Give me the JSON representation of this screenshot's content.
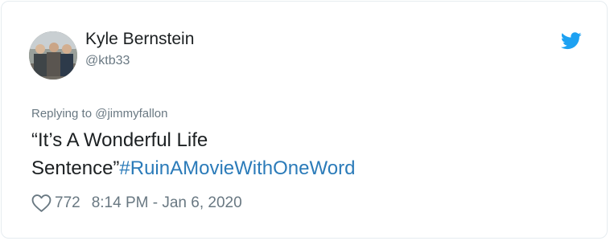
{
  "tweet": {
    "author": {
      "display_name": "Kyle Bernstein",
      "handle": "@ktb33"
    },
    "reply": {
      "prefix": "Replying to",
      "target": "@jimmyfallon"
    },
    "text_line1": "“It’s A Wonderful Life",
    "text_line2": "Sentence”",
    "hashtag": "#RuinAMovieWithOneWord",
    "likes": "772",
    "timestamp": "8:14 PM - Jan 6, 2020"
  },
  "icons": {
    "brand": "twitter-bird-icon",
    "like": "heart-icon"
  },
  "colors": {
    "brand_blue": "#1da1f2",
    "link_blue": "#2b7bb9",
    "text_primary": "#1c2022",
    "text_secondary": "#697882"
  }
}
